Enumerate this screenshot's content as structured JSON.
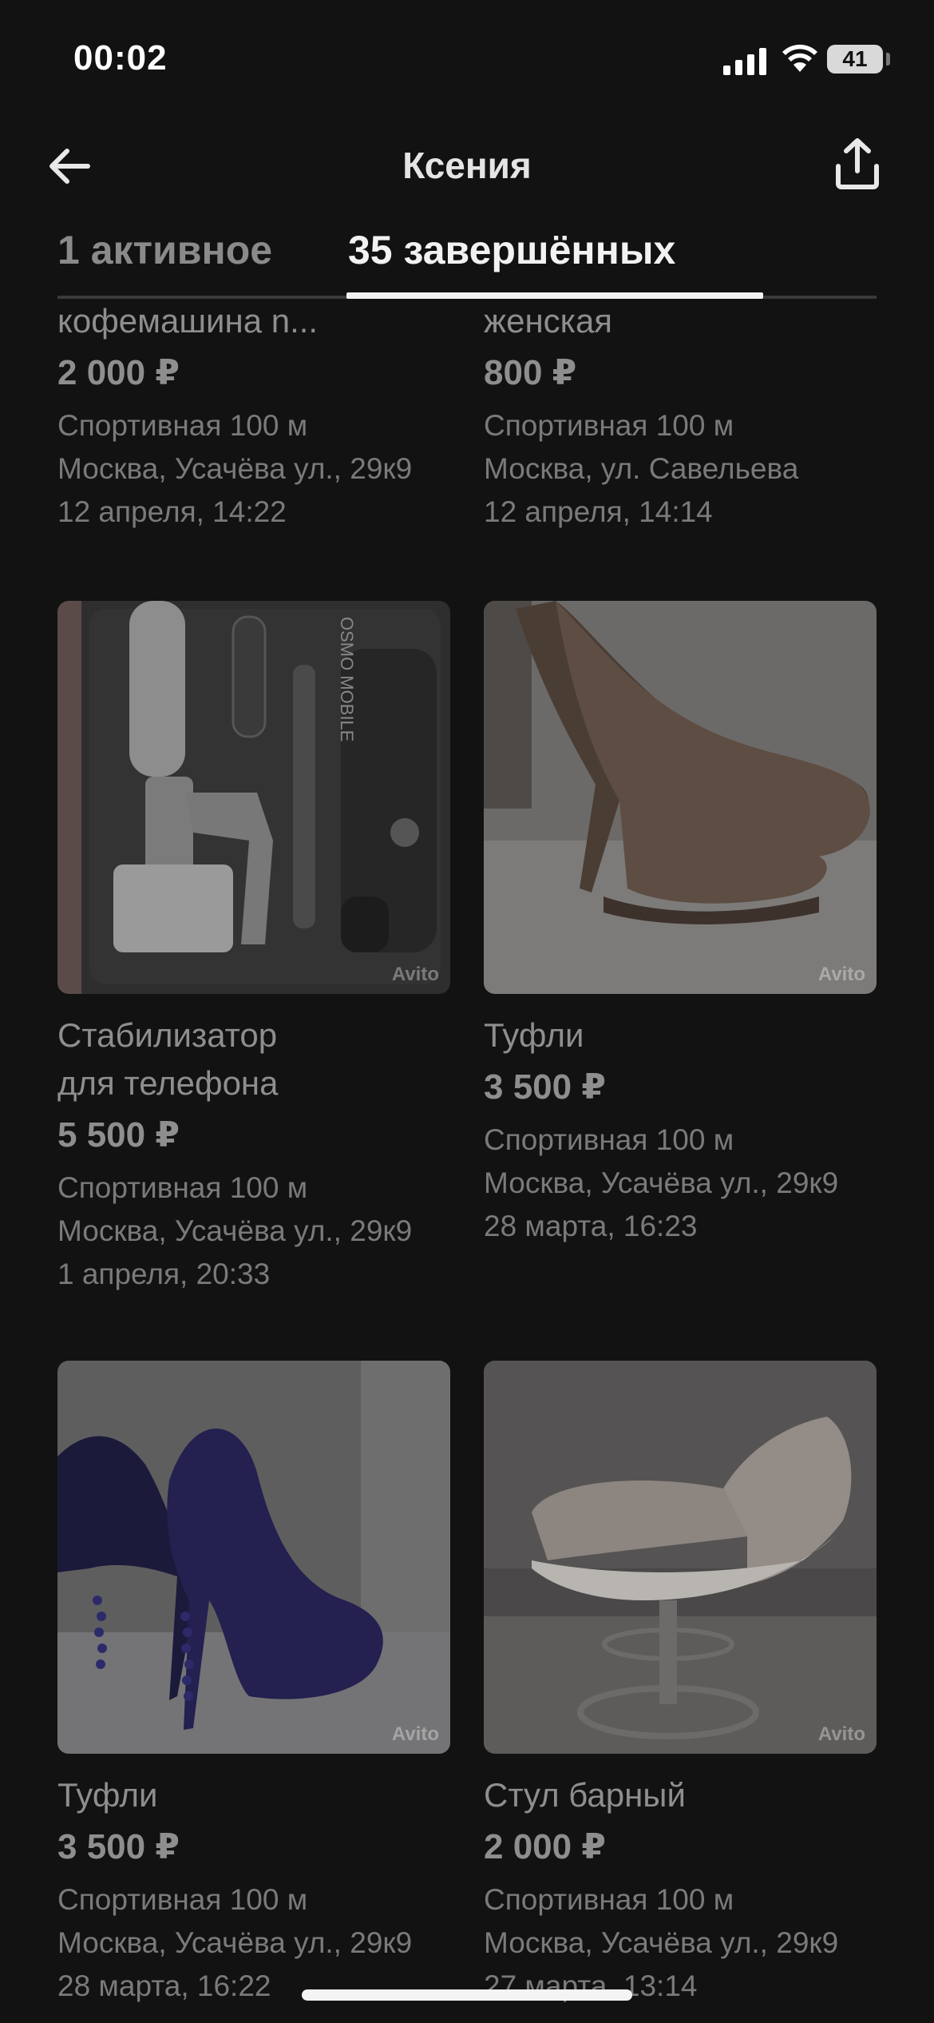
{
  "status_bar": {
    "time": "00:02",
    "battery": "41"
  },
  "header": {
    "title": "Ксения"
  },
  "tabs": [
    {
      "label": "1 активное",
      "active": false
    },
    {
      "label": "35 завершённых",
      "active": true
    }
  ],
  "listings": [
    {
      "title": "кофемашина n...",
      "price": "2 000 ₽",
      "metro": "Спортивная 100 м",
      "address": "Москва, Усачёва ул., 29к9",
      "date": "12 апреля, 14:22"
    },
    {
      "title": "женская",
      "price": "800 ₽",
      "metro": "Спортивная 100 м",
      "address": "Москва, ул. Савельева",
      "date": "12 апреля, 14:14"
    },
    {
      "title_line1": "Стабилизатор",
      "title_line2": "для телефона",
      "price": "5 500 ₽",
      "metro": "Спортивная 100 м",
      "address": "Москва, Усачёва ул., 29к9",
      "date": "1 апреля, 20:33",
      "watermark": "Avito",
      "image_text": "OSMO MOBILE"
    },
    {
      "title": "Туфли",
      "price": "3 500 ₽",
      "metro": "Спортивная 100 м",
      "address": "Москва, Усачёва ул., 29к9",
      "date": "28 марта, 16:23",
      "watermark": "Avito"
    },
    {
      "title": "Туфли",
      "price": "3 500 ₽",
      "metro": "Спортивная 100 м",
      "address": "Москва, Усачёва ул., 29к9",
      "date": "28 марта, 16:22",
      "watermark": "Avito"
    },
    {
      "title": "Стул барный",
      "price": "2 000 ₽",
      "metro": "Спортивная 100 м",
      "address": "Москва, Усачёва ул., 29к9",
      "date": "27 марта, 13:14",
      "watermark": "Avito"
    }
  ]
}
